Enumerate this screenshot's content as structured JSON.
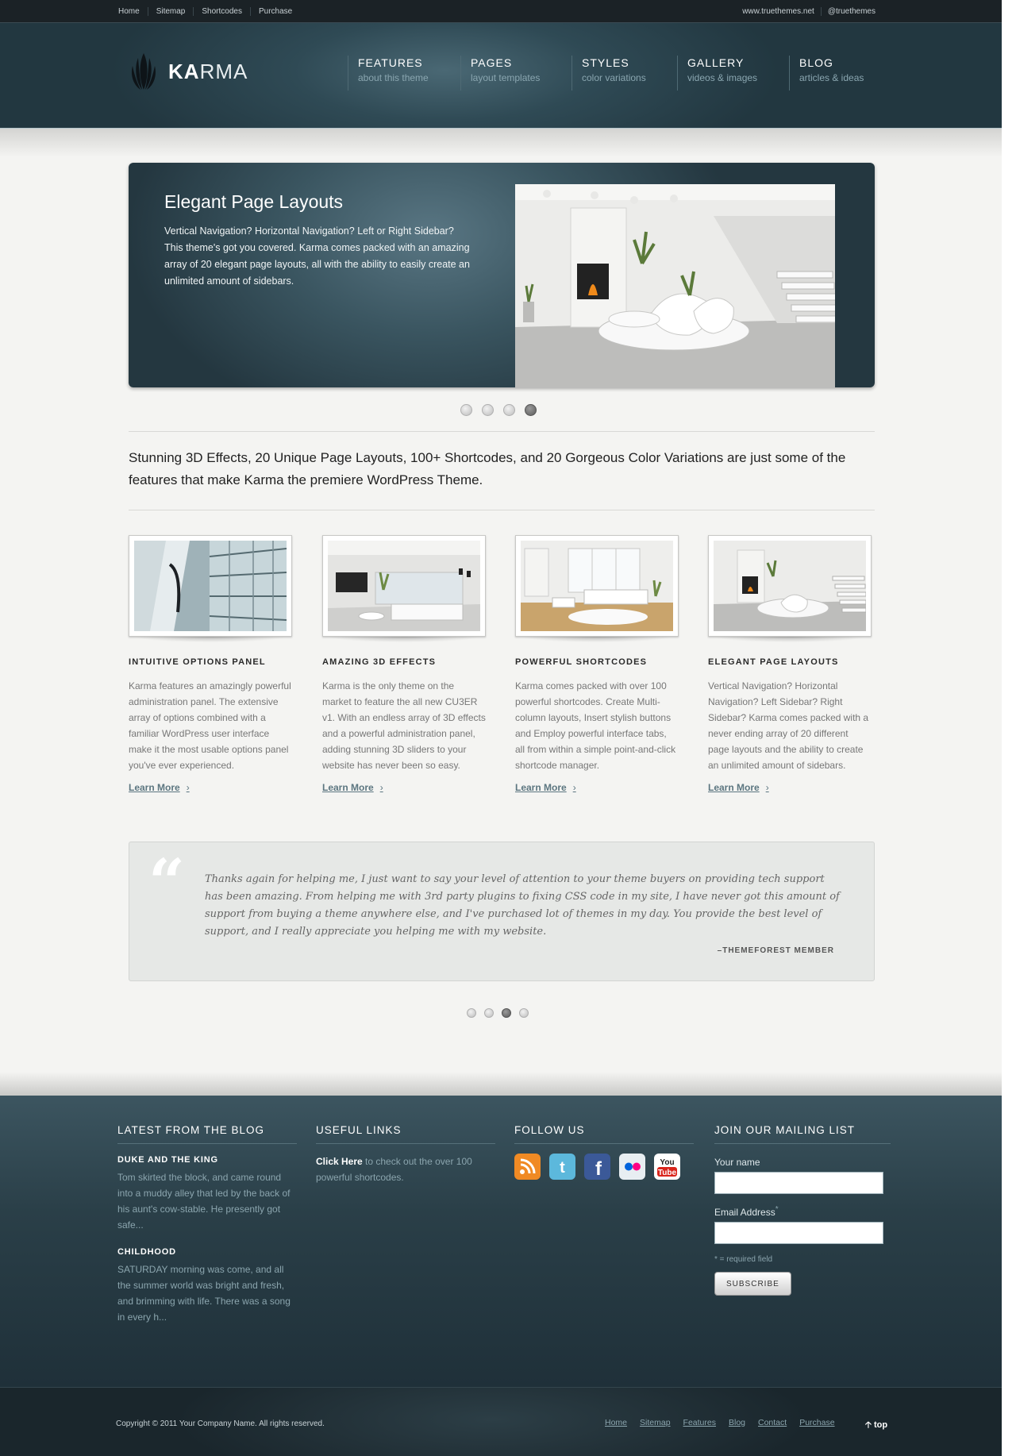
{
  "topbar": {
    "links": [
      "Home",
      "Sitemap",
      "Shortcodes",
      "Purchase"
    ],
    "right_links": [
      "www.truethemes.net",
      "@truethemes"
    ]
  },
  "logo": {
    "bold": "KA",
    "light": "RMA"
  },
  "nav": [
    {
      "title": "FEATURES",
      "subtitle": "about this theme"
    },
    {
      "title": "PAGES",
      "subtitle": "layout templates"
    },
    {
      "title": "STYLES",
      "subtitle": "color variations"
    },
    {
      "title": "GALLERY",
      "subtitle": "videos & images"
    },
    {
      "title": "BLOG",
      "subtitle": "articles & ideas"
    }
  ],
  "slider": {
    "title": "Elegant Page Layouts",
    "text": "Vertical Navigation? Horizontal Navigation? Left or Right Sidebar? This theme's got you covered. Karma comes packed with an amazing array of 20 elegant page layouts, all with the ability to easily create an unlimited amount of sidebars.",
    "active_slide": 4,
    "slide_count": 4
  },
  "intro": "Stunning 3D Effects, 20 Unique Page Layouts, 100+ Shortcodes, and 20 Gorgeous Color Variations are just some of the features that make Karma the premiere WordPress Theme.",
  "features": [
    {
      "title": "INTUITIVE OPTIONS PANEL",
      "text": "Karma features an amazingly powerful administration panel. The extensive array of options combined with a familiar WordPress user interface make it the most usable options panel you've ever experienced.",
      "link": "Learn More"
    },
    {
      "title": "AMAZING 3D EFFECTS",
      "text": "Karma is the only theme on the market to feature the all new CU3ER v1. With an endless array of 3D effects and a powerful administration panel, adding stunning 3D sliders to your website has never been so easy.",
      "link": "Learn More"
    },
    {
      "title": "POWERFUL SHORTCODES",
      "text": "Karma comes packed with over 100 powerful shortcodes. Create Multi-column layouts, Insert stylish buttons and Employ powerful interface tabs, all from within a simple point-and-click shortcode manager.",
      "link": "Learn More"
    },
    {
      "title": "ELEGANT PAGE LAYOUTS",
      "text": "Vertical Navigation? Horizontal Navigation? Left Sidebar? Right Sidebar? Karma comes packed with a never ending array of 20 different page layouts and the ability to create an unlimited amount of sidebars.",
      "link": "Learn More"
    }
  ],
  "testimonial": {
    "quote": "Thanks again for helping me, I just want to say your level of attention to your theme buyers on providing tech support has been amazing. From helping me with 3rd party plugins to fixing CSS code in my site, I have never got this amount of support from buying a theme anywhere else, and I've purchased lot of themes in my day. You provide the best level of support, and I really appreciate you helping me with my website.",
    "author": "–THEMEFOREST MEMBER",
    "active_slide": 3,
    "slide_count": 4
  },
  "footer": {
    "blog": {
      "heading": "LATEST FROM THE BLOG",
      "posts": [
        {
          "title": "DUKE AND THE KING",
          "excerpt": "Tom skirted the block, and came round into a muddy alley that led by the back of his aunt's cow-stable. He presently got safe..."
        },
        {
          "title": "CHILDHOOD",
          "excerpt": "SATURDAY morning was come, and all the summer world was bright and fresh, and brimming with life. There was a song in every h..."
        }
      ]
    },
    "links": {
      "heading": "USEFUL LINKS",
      "link_label": "Click Here",
      "text": " to check out the over 100 powerful shortcodes."
    },
    "follow": {
      "heading": "FOLLOW US",
      "icons": [
        "rss-icon",
        "twitter-icon",
        "facebook-icon",
        "flickr-icon",
        "youtube-icon"
      ],
      "colors": [
        "#f08a24",
        "#5cb8dc",
        "#3b5998",
        "#e8eef2",
        "#d9251c"
      ]
    },
    "mailing": {
      "heading": "JOIN OUR MAILING LIST",
      "name_label": "Your name",
      "email_label": "Email Address",
      "required_mark": "*",
      "required_note": "* = required field",
      "button": "SUBSCRIBE"
    }
  },
  "bottom": {
    "copyright": "Copyright © 2011 Your Company Name. All rights reserved.",
    "links": [
      "Home",
      "Sitemap",
      "Features",
      "Blog",
      "Contact",
      "Purchase"
    ],
    "top_label": "top"
  }
}
